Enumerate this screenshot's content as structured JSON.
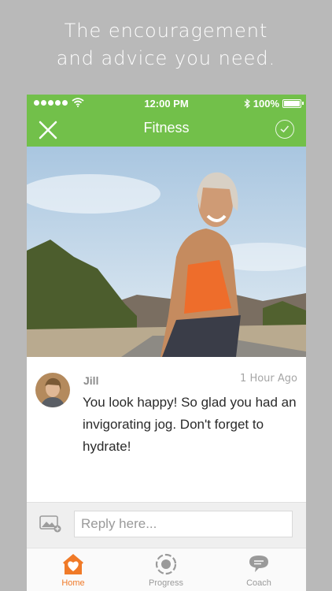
{
  "headline": {
    "line1": "The encouragement",
    "line2": "and advice you need."
  },
  "status_bar": {
    "time": "12:00 PM",
    "battery": "100%"
  },
  "nav": {
    "title": "Fitness"
  },
  "message": {
    "author": "Jill",
    "timestamp": "1 Hour Ago",
    "text": "You look happy! So glad you had an invigorating jog. Don't forget to hydrate!"
  },
  "reply": {
    "placeholder": "Reply here..."
  },
  "tabs": [
    {
      "label": "Home",
      "icon": "home-heart-icon",
      "active": true
    },
    {
      "label": "Progress",
      "icon": "progress-ring-icon",
      "active": false
    },
    {
      "label": "Coach",
      "icon": "speech-bubble-icon",
      "active": false
    }
  ],
  "colors": {
    "background": "#b9b9b9",
    "accent_green": "#72c04a",
    "active_tab": "#f07a28",
    "inactive_tab": "#9a9a9a"
  }
}
